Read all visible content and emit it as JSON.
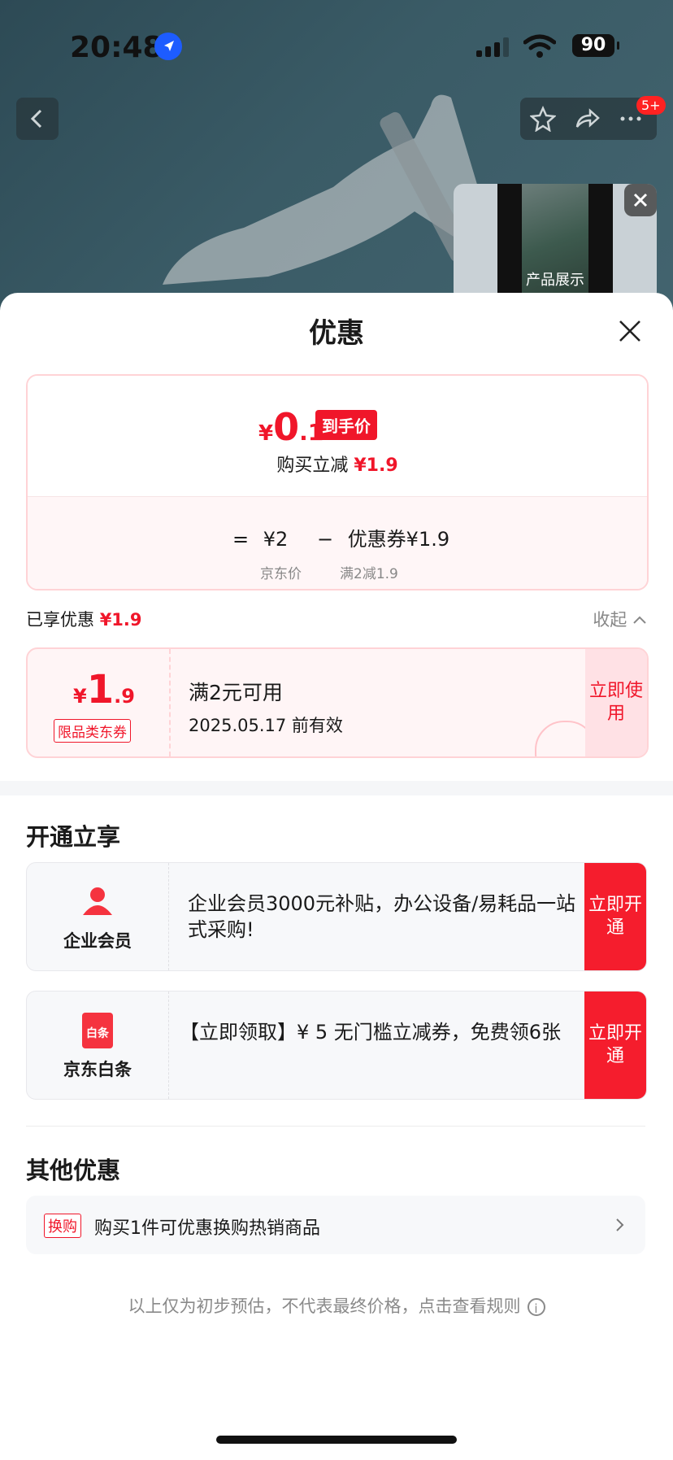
{
  "status": {
    "time": "20:48",
    "battery": "90"
  },
  "nav": {
    "badge": "5+"
  },
  "video": {
    "label": "产品展示"
  },
  "sheet": {
    "title": "优惠",
    "price": {
      "currency": "¥",
      "integer": "0",
      "decimal": ".1",
      "tag": "到手价"
    },
    "reduce": {
      "label": "购买立减",
      "amount": "¥1.9"
    },
    "breakdown": {
      "eq": "=",
      "jd_price": "¥2",
      "jd_price_label": "京东价",
      "minus": "−",
      "coupon": "优惠券¥1.9",
      "coupon_label": "满2减1.9"
    },
    "enjoyed": {
      "label": "已享优惠",
      "amount": "¥1.9",
      "collapse": "收起"
    },
    "coupon": {
      "currency": "¥",
      "integer": "1",
      "decimal": ".9",
      "tag": "限品类东券",
      "condition": "满2元可用",
      "valid": "2025.05.17 前有效",
      "action": "立即使用"
    },
    "open_section": "开通立享",
    "promos": [
      {
        "name": "企业会员",
        "desc": " 企业会员3000元补贴，办公设备/易耗品一站式采购!",
        "action": "立即开通"
      },
      {
        "name": "京东白条",
        "icon_text": "白条",
        "desc": "【立即领取】¥ 5 无门槛立减券，免费领6张",
        "action": "立即开通"
      }
    ],
    "other_section": "其他优惠",
    "exchange": {
      "tag": "换购",
      "text": "购买1件可优惠换购热销商品"
    },
    "note": "以上仅为初步预估，不代表最终价格，点击查看规则"
  },
  "colors": {
    "accent": "#f0162a",
    "button_red": "#f51d2d",
    "coupon_bg": "#fff5f6"
  }
}
